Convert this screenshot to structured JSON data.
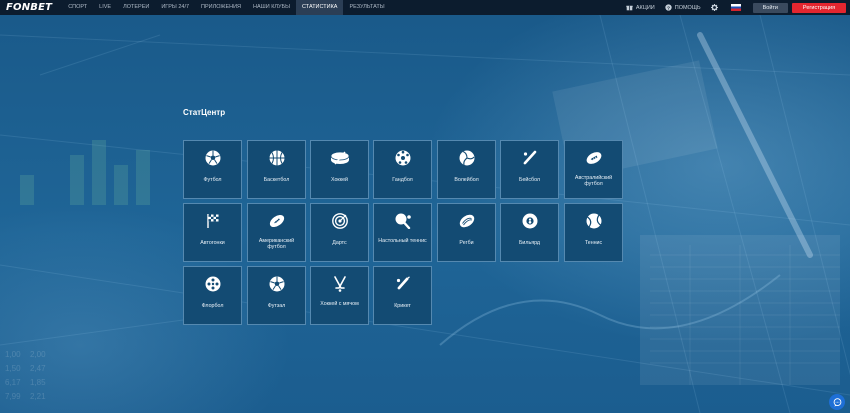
{
  "brand": {
    "logo": "FONBET"
  },
  "nav": {
    "items": [
      {
        "label": "СПОРТ",
        "active": false
      },
      {
        "label": "LIVE",
        "active": false
      },
      {
        "label": "ЛОТЕРЕИ",
        "active": false
      },
      {
        "label": "ИГРЫ 24/7",
        "active": false
      },
      {
        "label": "ПРИЛОЖЕНИЯ",
        "active": false
      },
      {
        "label": "НАШИ КЛУБЫ",
        "active": false
      },
      {
        "label": "СТАТИСТИКА",
        "active": true
      },
      {
        "label": "РЕЗУЛЬТАТЫ",
        "active": false
      }
    ]
  },
  "right_nav": {
    "promo": {
      "label": "АКЦИИ",
      "icon": "gift-icon"
    },
    "help": {
      "label": "ПОМОЩЬ",
      "icon": "help-icon"
    },
    "settings_icon": "gear-icon",
    "language_icon": "russia-flag-icon",
    "login_label": "Войти",
    "register_label": "Регистрация"
  },
  "section": {
    "title": "СтатЦентр"
  },
  "sports": [
    {
      "label": "Футбол",
      "icon": "soccer-ball-icon"
    },
    {
      "label": "Баскетбол",
      "icon": "basketball-icon"
    },
    {
      "label": "Хоккей",
      "icon": "hockey-puck-icon"
    },
    {
      "label": "Гандбол",
      "icon": "handball-icon"
    },
    {
      "label": "Волейбол",
      "icon": "volleyball-icon"
    },
    {
      "label": "Бейсбол",
      "icon": "baseball-bat-icon"
    },
    {
      "label": "Австралийский футбол",
      "icon": "aussie-rules-ball-icon"
    },
    {
      "label": "Автогонки",
      "icon": "racing-flag-icon"
    },
    {
      "label": "Американский футбол",
      "icon": "american-football-icon"
    },
    {
      "label": "Дартс",
      "icon": "darts-target-icon"
    },
    {
      "label": "Настольный теннис",
      "icon": "table-tennis-icon"
    },
    {
      "label": "Регби",
      "icon": "rugby-ball-icon"
    },
    {
      "label": "Бильярд",
      "icon": "billiard-ball-icon"
    },
    {
      "label": "Теннис",
      "icon": "tennis-ball-icon"
    },
    {
      "label": "Флорбол",
      "icon": "floorball-icon"
    },
    {
      "label": "Футзал",
      "icon": "futsal-ball-icon"
    },
    {
      "label": "Хоккей с мячом",
      "icon": "bandy-sticks-icon"
    },
    {
      "label": "Крикет",
      "icon": "cricket-bat-icon"
    }
  ],
  "chat": {
    "icon": "chat-icon"
  }
}
